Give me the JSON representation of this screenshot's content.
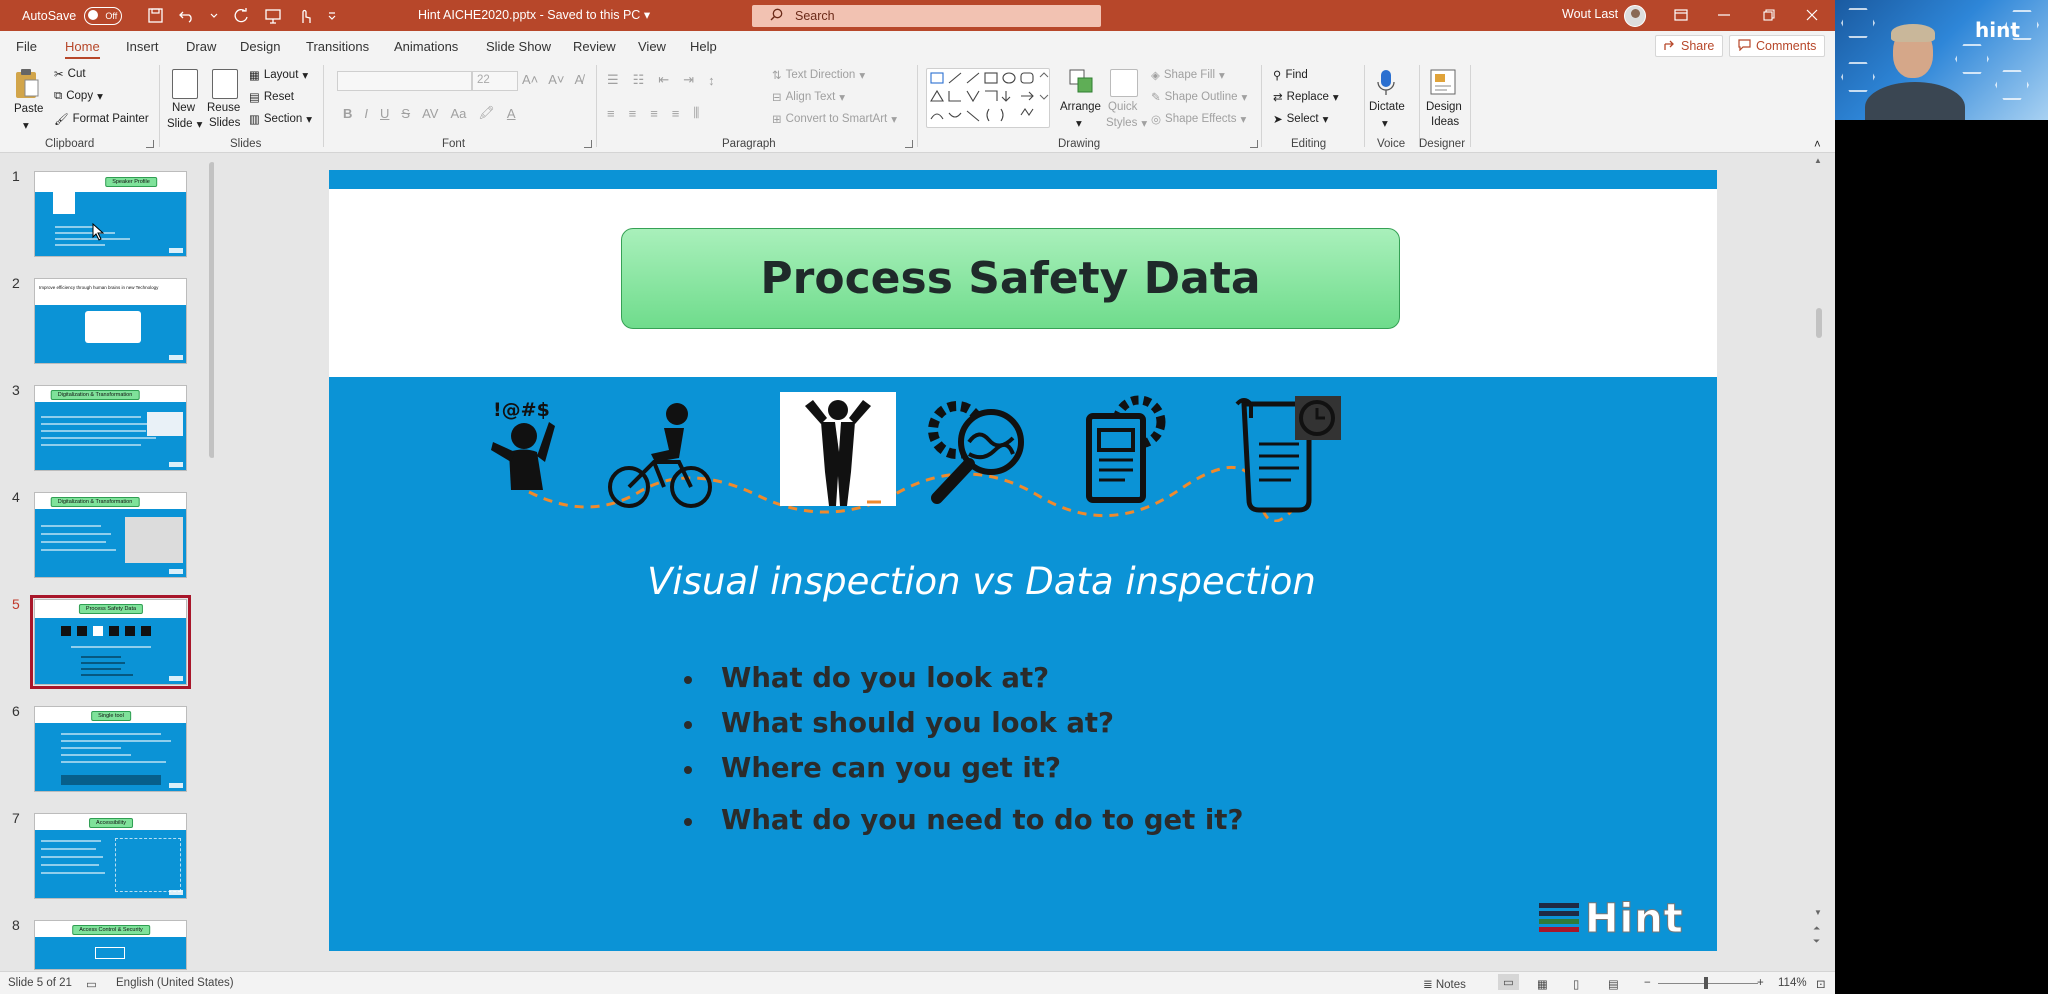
{
  "titlebar": {
    "autosave_label": "AutoSave",
    "autosave_state": "Off",
    "filename": "Hint AICHE2020.pptx  -  Saved to this PC",
    "search_placeholder": "Search",
    "user_name": "Wout Last"
  },
  "tabs": [
    "File",
    "Home",
    "Insert",
    "Draw",
    "Design",
    "Transitions",
    "Animations",
    "Slide Show",
    "Review",
    "View",
    "Help"
  ],
  "active_tab": "Home",
  "share_label": "Share",
  "comments_label": "Comments",
  "ribbon": {
    "clipboard": {
      "paste": "Paste",
      "cut": "Cut",
      "copy": "Copy",
      "format_painter": "Format Painter",
      "label": "Clipboard"
    },
    "slides": {
      "new_slide": "New",
      "new_slide2": "Slide",
      "reuse": "Reuse",
      "reuse2": "Slides",
      "layout": "Layout",
      "reset": "Reset",
      "section": "Section",
      "label": "Slides"
    },
    "font": {
      "font_size": "22",
      "label": "Font"
    },
    "paragraph": {
      "text_direction": "Text Direction",
      "align_text": "Align Text",
      "convert_smartart": "Convert to SmartArt",
      "label": "Paragraph"
    },
    "drawing": {
      "arrange": "Arrange",
      "quick": "Quick",
      "styles": "Styles",
      "shape_fill": "Shape Fill",
      "shape_outline": "Shape Outline",
      "shape_effects": "Shape Effects",
      "label": "Drawing"
    },
    "editing": {
      "find": "Find",
      "replace": "Replace",
      "select": "Select",
      "label": "Editing"
    },
    "voice": {
      "dictate": "Dictate",
      "label": "Voice"
    },
    "designer": {
      "design": "Design",
      "ideas": "Ideas",
      "label": "Designer"
    }
  },
  "thumbnails": [
    {
      "num": "1",
      "title": "Speaker Profile"
    },
    {
      "num": "2",
      "title": "Improve efficiency through human brains in new Technology"
    },
    {
      "num": "3",
      "title": "Digitalization & Transformation"
    },
    {
      "num": "4",
      "title": "Digitalization & Transformation"
    },
    {
      "num": "5",
      "title": "Process Safety Data"
    },
    {
      "num": "6",
      "title": "Single tool"
    },
    {
      "num": "7",
      "title": "Accessibility"
    },
    {
      "num": "8",
      "title": "Access Control & Security"
    }
  ],
  "selected_slide": "5",
  "slide": {
    "title": "Process Safety Data",
    "icon_caption": "!@#$",
    "subtitle": "Visual inspection vs Data inspection",
    "bullets": [
      "What do you look at?",
      "What should you look at?",
      "Where can you get it?",
      "What do you need to do to get it?"
    ],
    "logo_text": "Hint"
  },
  "status": {
    "slide_of": "Slide 5 of 21",
    "language": "English (United States)",
    "notes": "Notes",
    "zoom": "114%"
  },
  "webcam": {
    "logo_text": "hint"
  },
  "colors": {
    "accent": "#b7472a",
    "slide_blue": "#0b93d6",
    "title_green": "#7fe29a"
  }
}
